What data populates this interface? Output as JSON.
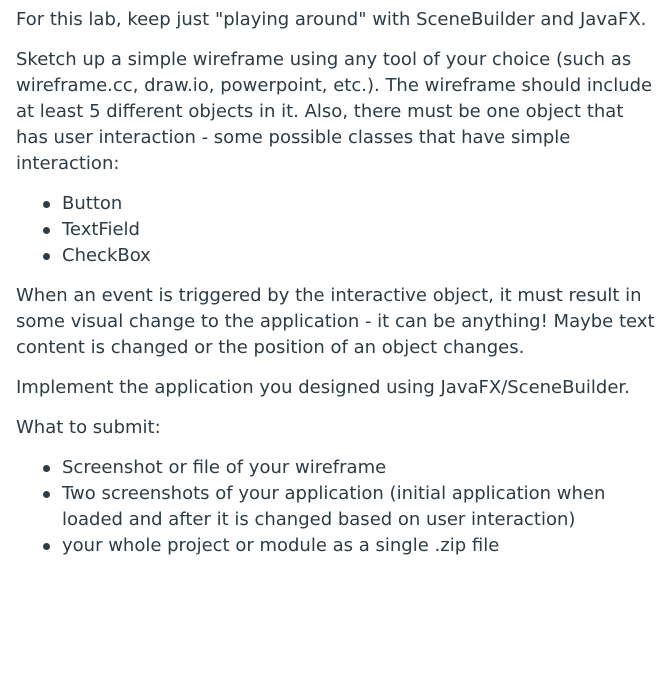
{
  "paragraphs": {
    "intro": "For this lab, keep just \"playing around\" with SceneBuilder and JavaFX.",
    "sketch": "Sketch up a simple wireframe using any tool of your choice (such as wireframe.cc, draw.io, powerpoint, etc.).  The wireframe should include at least 5 different objects in it. Also, there must be one object that has user interaction - some possible classes that have simple interaction:",
    "event": "When an event is triggered by the interactive object, it must result in some visual change to the application - it can be anything!  Maybe text content is changed or the position of an object changes.",
    "implement": "Implement the application you designed using JavaFX/SceneBuilder.",
    "submit_heading": "What to submit:"
  },
  "interaction_classes": [
    "Button",
    "TextField",
    "CheckBox"
  ],
  "submit_items": [
    "Screenshot or file of your wireframe",
    "Two screenshots of your application (initial application when loaded and after it is changed based on user interaction)",
    "your whole project or module as a single .zip file"
  ]
}
